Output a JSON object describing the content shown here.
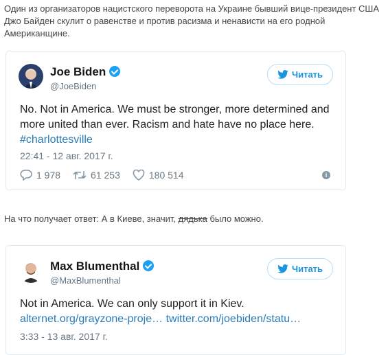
{
  "intro_text": "Один из организаторов нацистского переворота на Украине бывший вице-президент США Джо Байден скулит о равенстве и против расизма и ненависти на его родной Американщине.",
  "tweet1": {
    "name": "Joe Biden",
    "handle": "@JoeBiden",
    "follow_label": "Читать",
    "text": "No. Not in America. We must be stronger, more determined and more united than ever. Racism and hate have no place here.",
    "hashtag": "#charlottesville",
    "timestamp": "22:41 - 12 авг. 2017 г.",
    "replies": "1 978",
    "retweets": "61 253",
    "likes": "180 514",
    "icons": [
      "reply-icon",
      "retweet-icon",
      "heart-icon",
      "info-icon",
      "twitter-bird-icon",
      "verified-badge-icon"
    ]
  },
  "middle_text": {
    "before": "На что получает ответ: А в Киеве, значит, ",
    "struck": "дядька",
    "after": " было можно."
  },
  "tweet2": {
    "name": "Max Blumenthal",
    "handle": "@MaxBlumenthal",
    "follow_label": "Читать",
    "text": "Not in America. We can only support it in Kiev.",
    "link1": "alternet.org/grayzone-proje…",
    "link2": "twitter.com/joebiden/statu…",
    "timestamp": "3:33 - 13 авг. 2017 г."
  },
  "colors": {
    "accent": "#1da1f2",
    "link": "#2b7bb9",
    "muted": "#697882",
    "border": "#e1e8ed"
  }
}
